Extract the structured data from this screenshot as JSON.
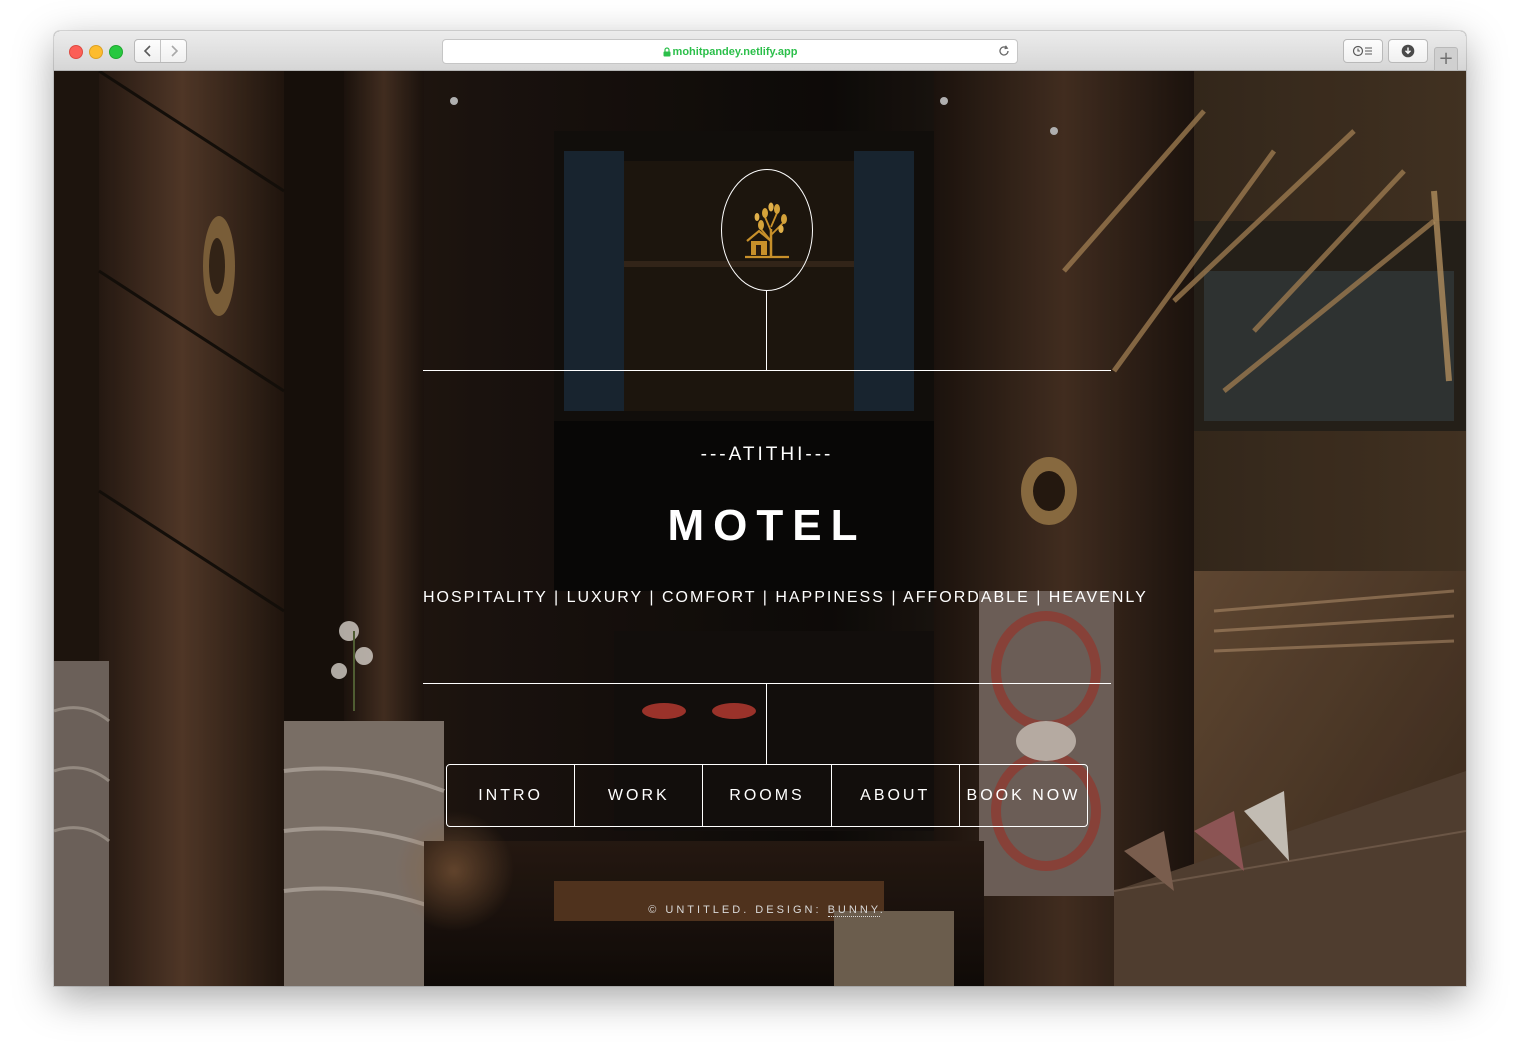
{
  "browser": {
    "url": "mohitpandey.netlify.app",
    "new_tab_label": "+",
    "colors": {
      "url_text": "#2bbf4a",
      "traffic_red": "#fc5f57",
      "traffic_yellow": "#fdbc2e",
      "traffic_green": "#28c840"
    }
  },
  "site": {
    "logo_icon": "golden-tree-house-logo",
    "tag": "---ATITHI---",
    "title": "MOTEL",
    "subtitle": "HOSPITALITY | LUXURY | COMFORT | HAPPINESS | AFFORDABLE | HEAVENLY",
    "nav": [
      {
        "label": "INTRO"
      },
      {
        "label": "WORK"
      },
      {
        "label": "ROOMS"
      },
      {
        "label": "ABOUT"
      },
      {
        "label": "BOOK NOW"
      }
    ],
    "footer_prefix": "© UNTITLED. DESIGN: ",
    "footer_credit": "BUNNY",
    "footer_suffix": ".",
    "colors": {
      "text": "#ffffff",
      "logo_gold": "#c8902a"
    }
  }
}
